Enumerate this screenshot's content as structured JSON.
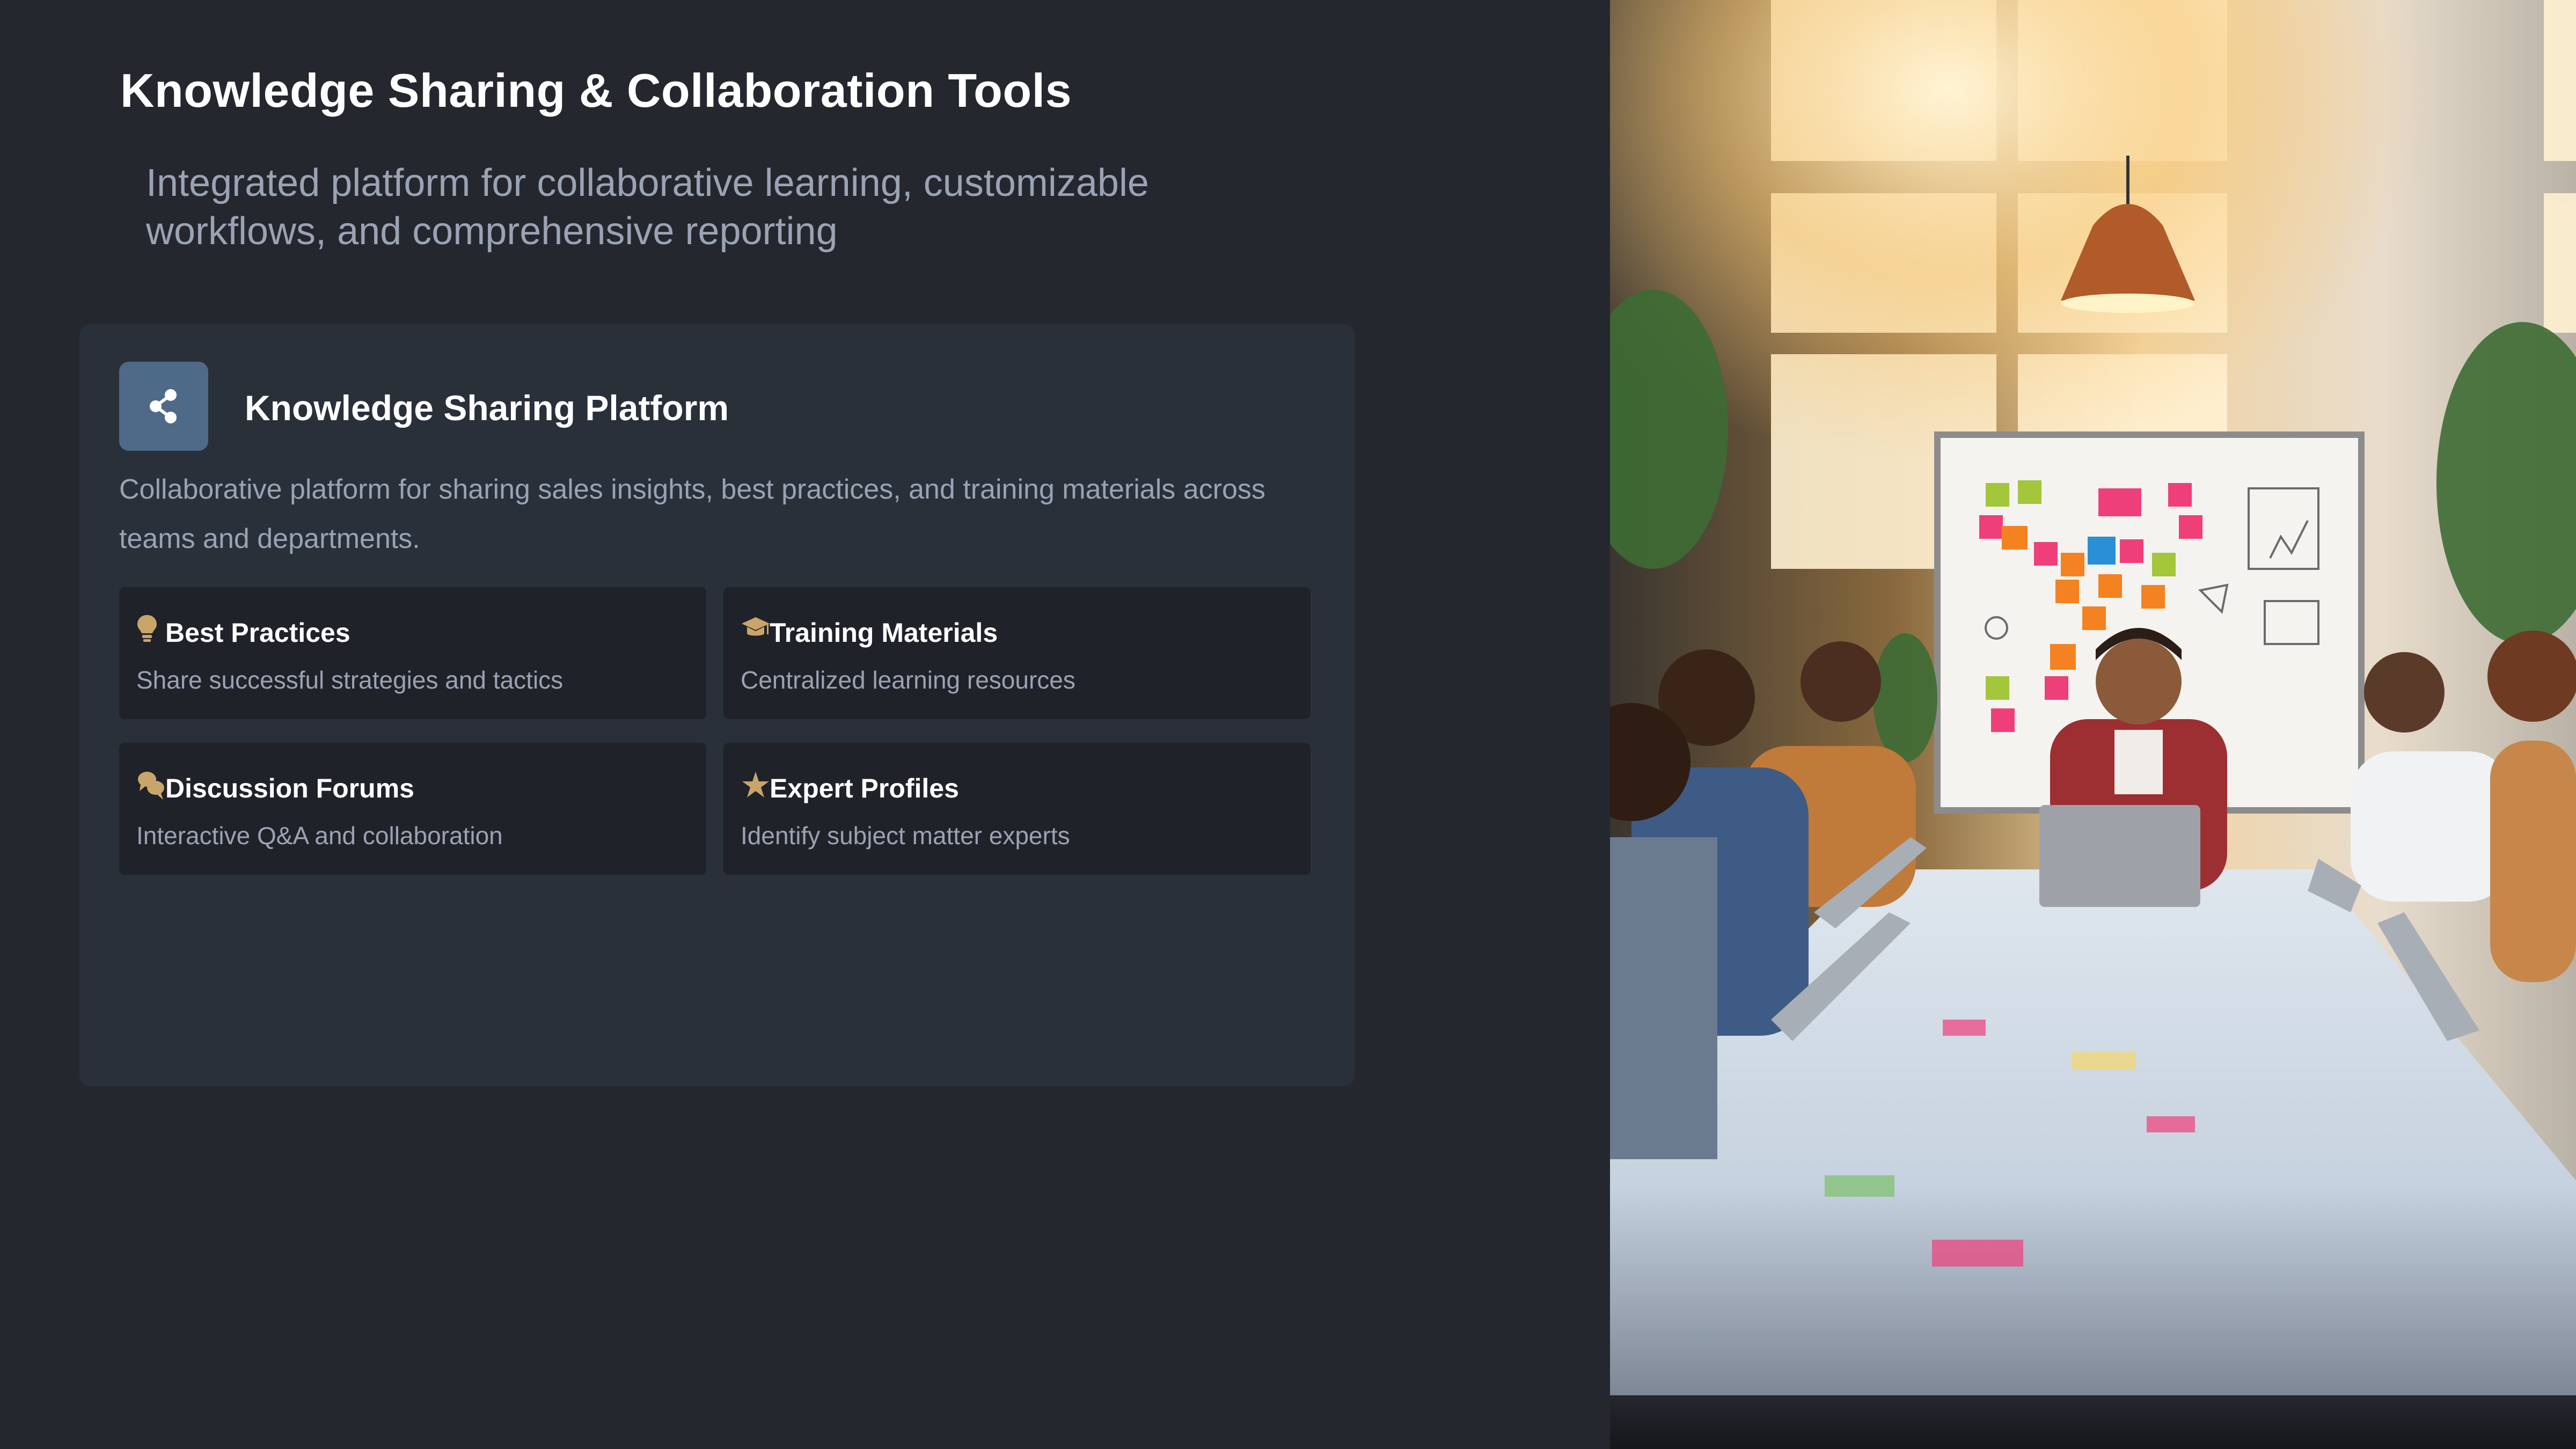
{
  "header": {
    "title": "Knowledge Sharing & Collaboration Tools",
    "subtitle": "Integrated platform for collaborative learning, customizable workflows, and comprehensive reporting"
  },
  "platform_card": {
    "icon": "share-icon",
    "title": "Knowledge Sharing Platform",
    "description": "Collaborative platform for sharing sales insights, best practices, and training materials across teams and departments.",
    "features": [
      {
        "icon": "lightbulb-icon",
        "title": "Best Practices",
        "description": "Share successful strategies and tactics"
      },
      {
        "icon": "graduation-cap-icon",
        "title": "Training Materials",
        "description": "Centralized learning resources"
      },
      {
        "icon": "comments-icon",
        "title": "Discussion Forums",
        "description": "Interactive Q&A and collaboration"
      },
      {
        "icon": "star-icon",
        "title": "Expert Profiles",
        "description": "Identify subject matter experts"
      }
    ]
  },
  "colors": {
    "background": "#24272e",
    "card": "#29303a",
    "feature_tile": "#1f2228",
    "icon_box": "#4f6a88",
    "accent_gold": "#c9a56b",
    "muted_text": "#9aa3b4"
  },
  "photo": {
    "icon": "team-meeting-photo"
  }
}
